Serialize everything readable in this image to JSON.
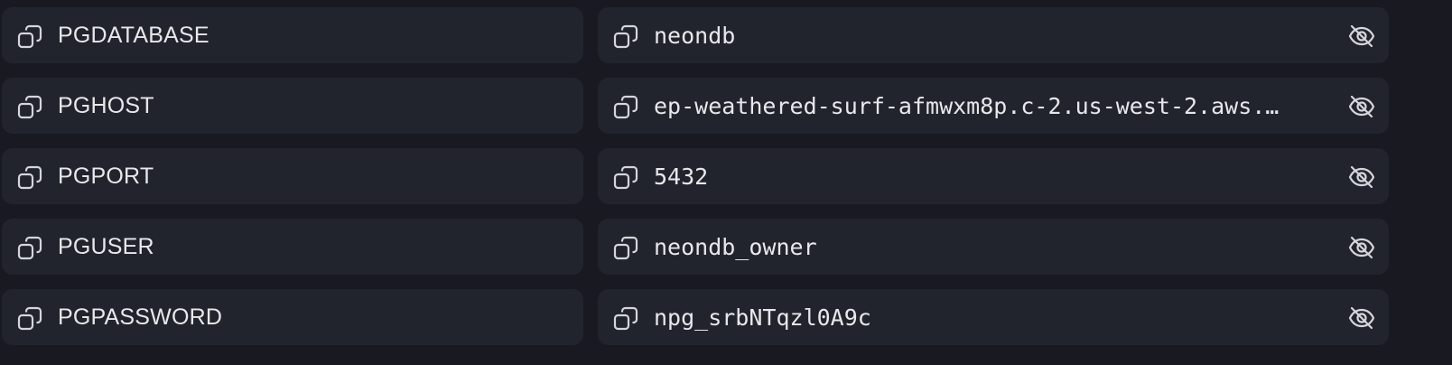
{
  "env_vars": [
    {
      "key": "PGDATABASE",
      "value": "neondb"
    },
    {
      "key": "PGHOST",
      "value": "ep-weathered-surf-afmwxm8p.c-2.us-west-2.aws.…"
    },
    {
      "key": "PGPORT",
      "value": "5432"
    },
    {
      "key": "PGUSER",
      "value": "neondb_owner"
    },
    {
      "key": "PGPASSWORD",
      "value": "npg_srbNTqzl0A9c"
    }
  ],
  "icons": {
    "copy": "copy-icon",
    "visibility": "eye-off-icon"
  },
  "colors": {
    "background": "#191a21",
    "cell": "#22242d",
    "text": "#e7e8eb",
    "icon": "#d4d6db"
  }
}
